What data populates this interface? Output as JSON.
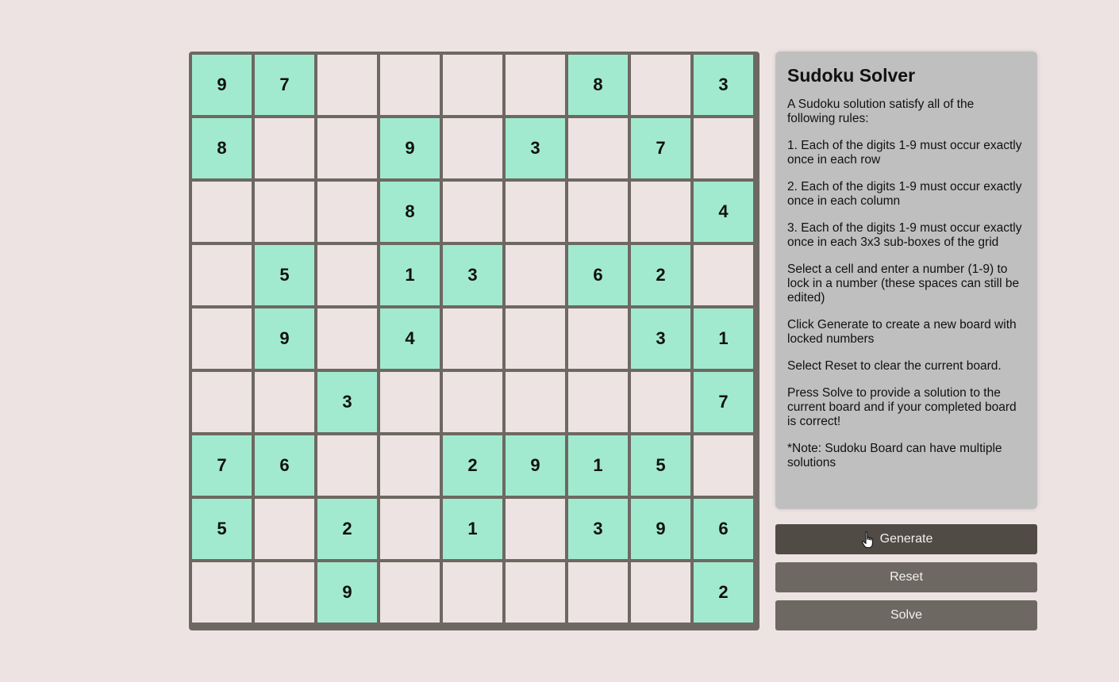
{
  "board": {
    "cells": [
      [
        "9",
        "7",
        "",
        "",
        "",
        "",
        "8",
        "",
        "3"
      ],
      [
        "8",
        "",
        "",
        "9",
        "",
        "3",
        "",
        "7",
        ""
      ],
      [
        "",
        "",
        "",
        "8",
        "",
        "",
        "",
        "",
        "4"
      ],
      [
        "",
        "5",
        "",
        "1",
        "3",
        "",
        "6",
        "2",
        ""
      ],
      [
        "",
        "9",
        "",
        "4",
        "",
        "",
        "",
        "3",
        "1"
      ],
      [
        "",
        "",
        "3",
        "",
        "",
        "",
        "",
        "",
        "7"
      ],
      [
        "7",
        "6",
        "",
        "",
        "2",
        "9",
        "1",
        "5",
        ""
      ],
      [
        "5",
        "",
        "2",
        "",
        "1",
        "",
        "3",
        "9",
        "6"
      ],
      [
        "",
        "",
        "9",
        "",
        "",
        "",
        "",
        "",
        "2"
      ]
    ],
    "colors": {
      "locked": "#a1ead0",
      "empty": "#ede3e2",
      "grid": "#6d6862"
    }
  },
  "panel": {
    "title": "Sudoku Solver",
    "paragraphs": [
      "A Sudoku solution satisfy all of the following rules:",
      "1. Each of the digits 1-9 must occur exactly once in each row",
      "2. Each of the digits 1-9 must occur exactly once in each column",
      "3. Each of the digits 1-9 must occur exactly once in each 3x3 sub-boxes of the grid",
      "Select a cell and enter a number (1-9) to lock in a number (these spaces can still be edited)",
      "Click Generate to create a new board with locked numbers",
      "Select Reset to clear the current board.",
      "Press Solve to provide a solution to the current board and if your completed board is correct!",
      "*Note: Sudoku Board can have multiple solutions"
    ]
  },
  "buttons": {
    "generate": "Generate",
    "reset": "Reset",
    "solve": "Solve"
  },
  "cursor": {
    "icon": "hand-pointer-icon"
  }
}
